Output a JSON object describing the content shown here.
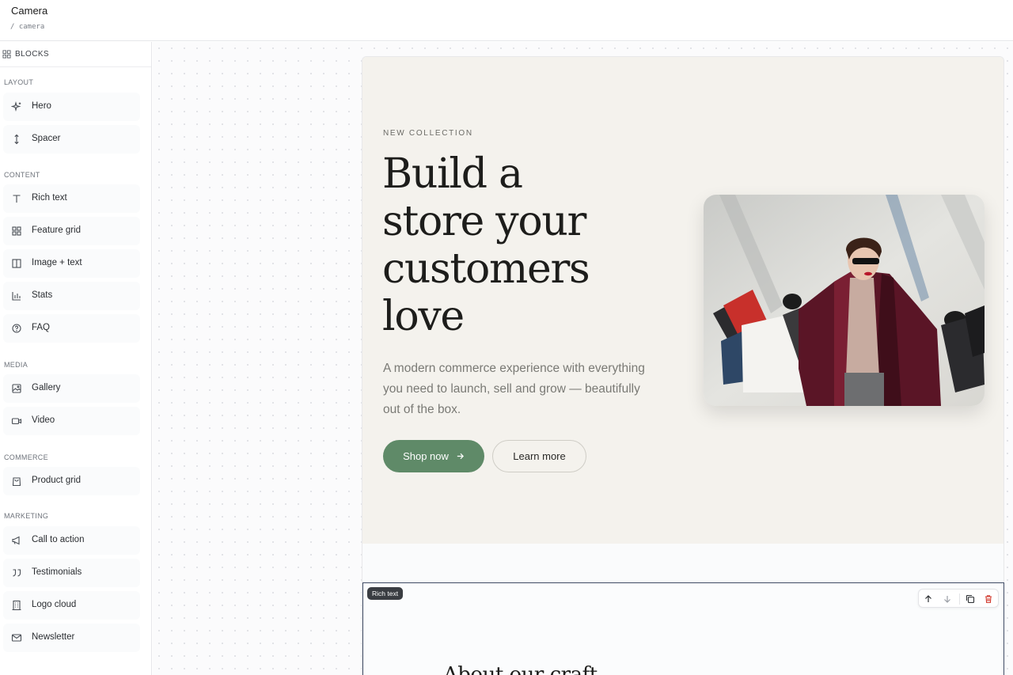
{
  "topbar": {
    "title": "Camera",
    "path": "/ camera"
  },
  "sidebar": {
    "header_label": "BLOCKS",
    "groups": [
      {
        "label": "LAYOUT",
        "items": [
          {
            "label": "Hero",
            "icon": "sparkles-icon"
          },
          {
            "label": "Spacer",
            "icon": "vertical-arrows-icon"
          }
        ]
      },
      {
        "label": "CONTENT",
        "items": [
          {
            "label": "Rich text",
            "icon": "type-icon"
          },
          {
            "label": "Feature grid",
            "icon": "grid-icon"
          },
          {
            "label": "Image + text",
            "icon": "columns-icon"
          },
          {
            "label": "Stats",
            "icon": "bar-chart-icon"
          },
          {
            "label": "FAQ",
            "icon": "help-circle-icon"
          }
        ]
      },
      {
        "label": "MEDIA",
        "items": [
          {
            "label": "Gallery",
            "icon": "gallery-icon"
          },
          {
            "label": "Video",
            "icon": "video-icon"
          }
        ]
      },
      {
        "label": "COMMERCE",
        "items": [
          {
            "label": "Product grid",
            "icon": "shopping-bag-icon"
          }
        ]
      },
      {
        "label": "MARKETING",
        "items": [
          {
            "label": "Call to action",
            "icon": "megaphone-icon"
          },
          {
            "label": "Testimonials",
            "icon": "quote-icon"
          },
          {
            "label": "Logo cloud",
            "icon": "building-icon"
          },
          {
            "label": "Newsletter",
            "icon": "mail-icon"
          }
        ]
      }
    ]
  },
  "hero": {
    "eyebrow": "NEW COLLECTION",
    "headline_lines": [
      "Build a",
      "store your",
      "customers",
      "love"
    ],
    "subtext": "A modern commerce experience with everything you need to launch, sell and grow — beautifully out of the box.",
    "primary_cta": "Shop now",
    "secondary_cta": "Learn more",
    "image_icon": "woman-with-shopping-bags-photo",
    "colors": {
      "background": "#f4f2ed",
      "primary": "#5f8a68"
    }
  },
  "selected_block": {
    "tag": "Rich text",
    "peek_text": "About our craft",
    "toolbar_icons": [
      "arrow-up-icon",
      "arrow-down-icon",
      "duplicate-icon",
      "trash-icon"
    ]
  }
}
